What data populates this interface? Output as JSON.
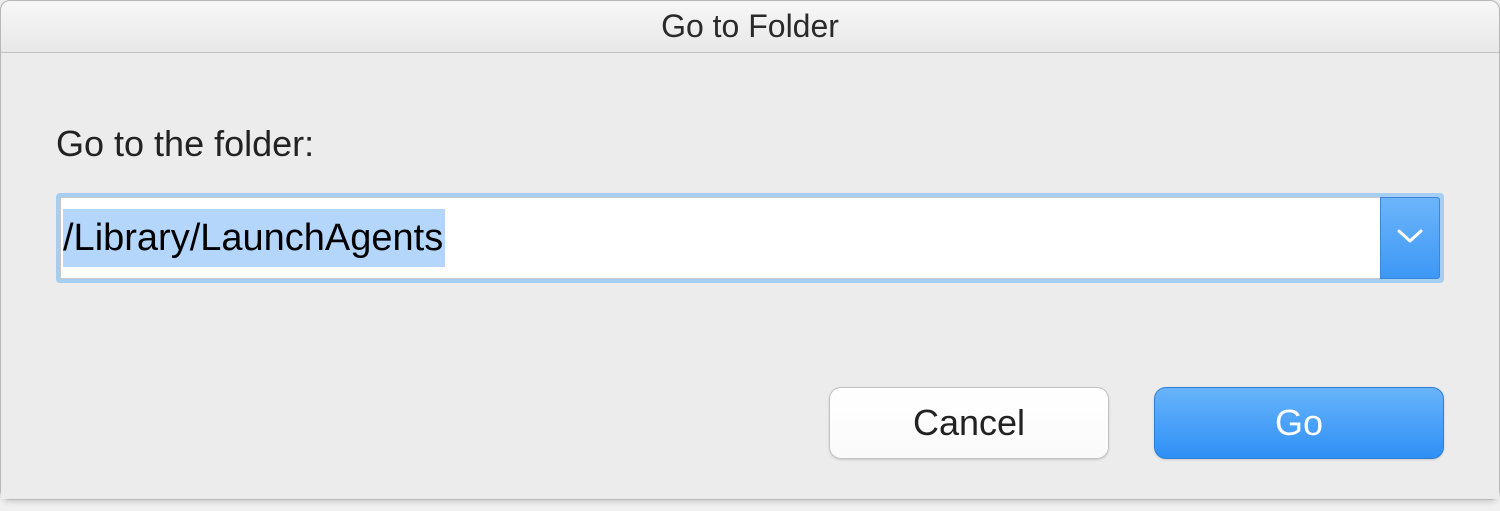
{
  "dialog": {
    "title": "Go to Folder",
    "prompt_label": "Go to the folder:",
    "path_value": "/Library/LaunchAgents",
    "buttons": {
      "cancel_label": "Cancel",
      "go_label": "Go"
    }
  }
}
